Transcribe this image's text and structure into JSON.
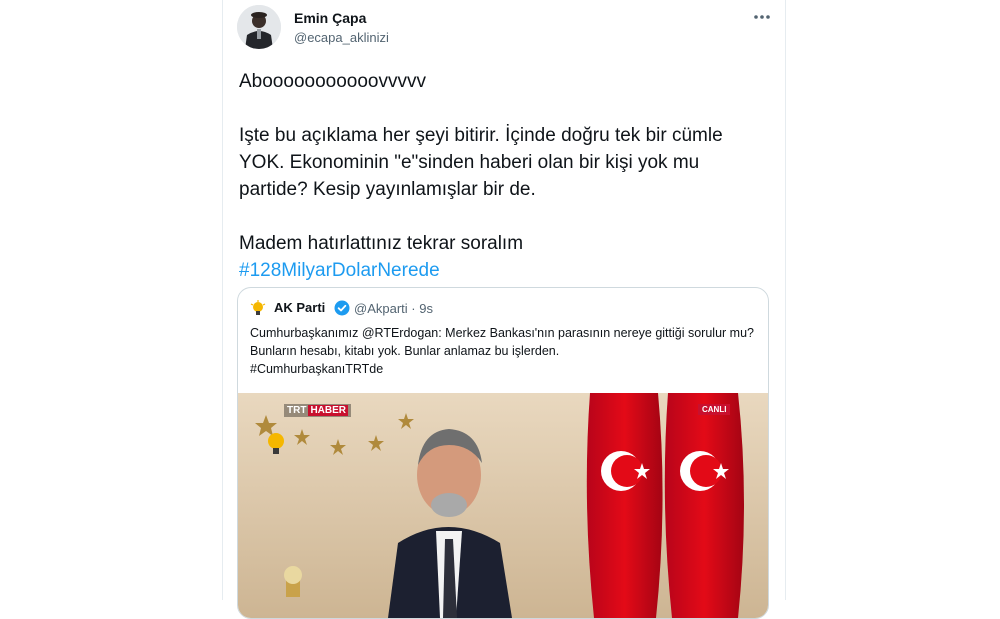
{
  "tweet": {
    "author_name": "Emin Çapa",
    "author_handle": "@ecapa_aklinizi",
    "paragraphs": [
      "Abooooooooooovvvvv",
      "Işte bu açıklama her şeyi bitirir. İçinde doğru tek bir cümle YOK. Ekonominin \"e\"sinden haberi olan bir kişi yok mu partide? Kesip yayınlamışlar bir de.",
      "Madem hatırlattınız tekrar soralım"
    ],
    "hashtag": "#128MilyarDolarNerede"
  },
  "quoted_tweet": {
    "author_name": "AK Parti",
    "handle_time": "@Akparti · 9s",
    "text_line": "Cumhurbaşkanımız @RTErdogan: Merkez Bankası'nın parasının nereye gittiği sorulur mu? Bunların hesabı, kitabı yok. Bunlar anlamaz bu işlerden.",
    "hashtag": "#CumhurbaşkanıTRTde",
    "media": {
      "channel_badge": "TRT",
      "channel_badge_2": "HABER",
      "live_badge": "CANLI"
    }
  },
  "icons": {
    "more": "more-icon",
    "verified": "verified-icon",
    "party_logo": "akparti-logo-icon"
  },
  "colors": {
    "link": "#1d9bf0",
    "muted": "#536471",
    "flag_red": "#e30a17"
  }
}
